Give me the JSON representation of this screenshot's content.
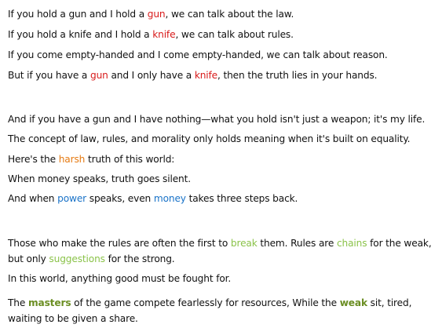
{
  "colors": {
    "red": "#d81b1b",
    "orange": "#e57a12",
    "blue": "#1a73c8",
    "green": "#8bc34a",
    "dark_green": "#6b8e23"
  },
  "para1": {
    "l1": [
      "If you hold a gun and I hold a ",
      "gun",
      ", we can talk about the law."
    ],
    "l2": [
      "If you hold a knife and I hold a ",
      "knife",
      ", we can talk about rules."
    ],
    "l3": "If you come empty-handed and I come empty-handed, we can talk about reason.",
    "l4": [
      "But if you have a ",
      "gun",
      " and I only have a ",
      "knife",
      ", then the truth lies in your hands."
    ]
  },
  "para2": {
    "l1": "And if you have a gun and I have nothing—what you hold isn't just a weapon; it's my life.",
    "l2": "The concept of law, rules, and morality only holds meaning when it's built on equality.",
    "l3": [
      "Here's the ",
      "harsh",
      " truth of this world:"
    ],
    "l4": "When money speaks, truth goes silent.",
    "l5": [
      "And when ",
      "power",
      " speaks, even ",
      "money",
      " takes three steps back."
    ]
  },
  "para3": {
    "l1": [
      "Those who make the rules are often the first to ",
      "break",
      " them. Rules are ",
      "chains",
      " for the weak, but only ",
      "suggestions",
      " for the strong."
    ],
    "l2": "In this world, anything good must be fought for.",
    "l3": [
      "The ",
      "masters",
      " of the game compete fearlessly for resources, While the ",
      "weak",
      " sit, tired, waiting to be given a share."
    ]
  }
}
